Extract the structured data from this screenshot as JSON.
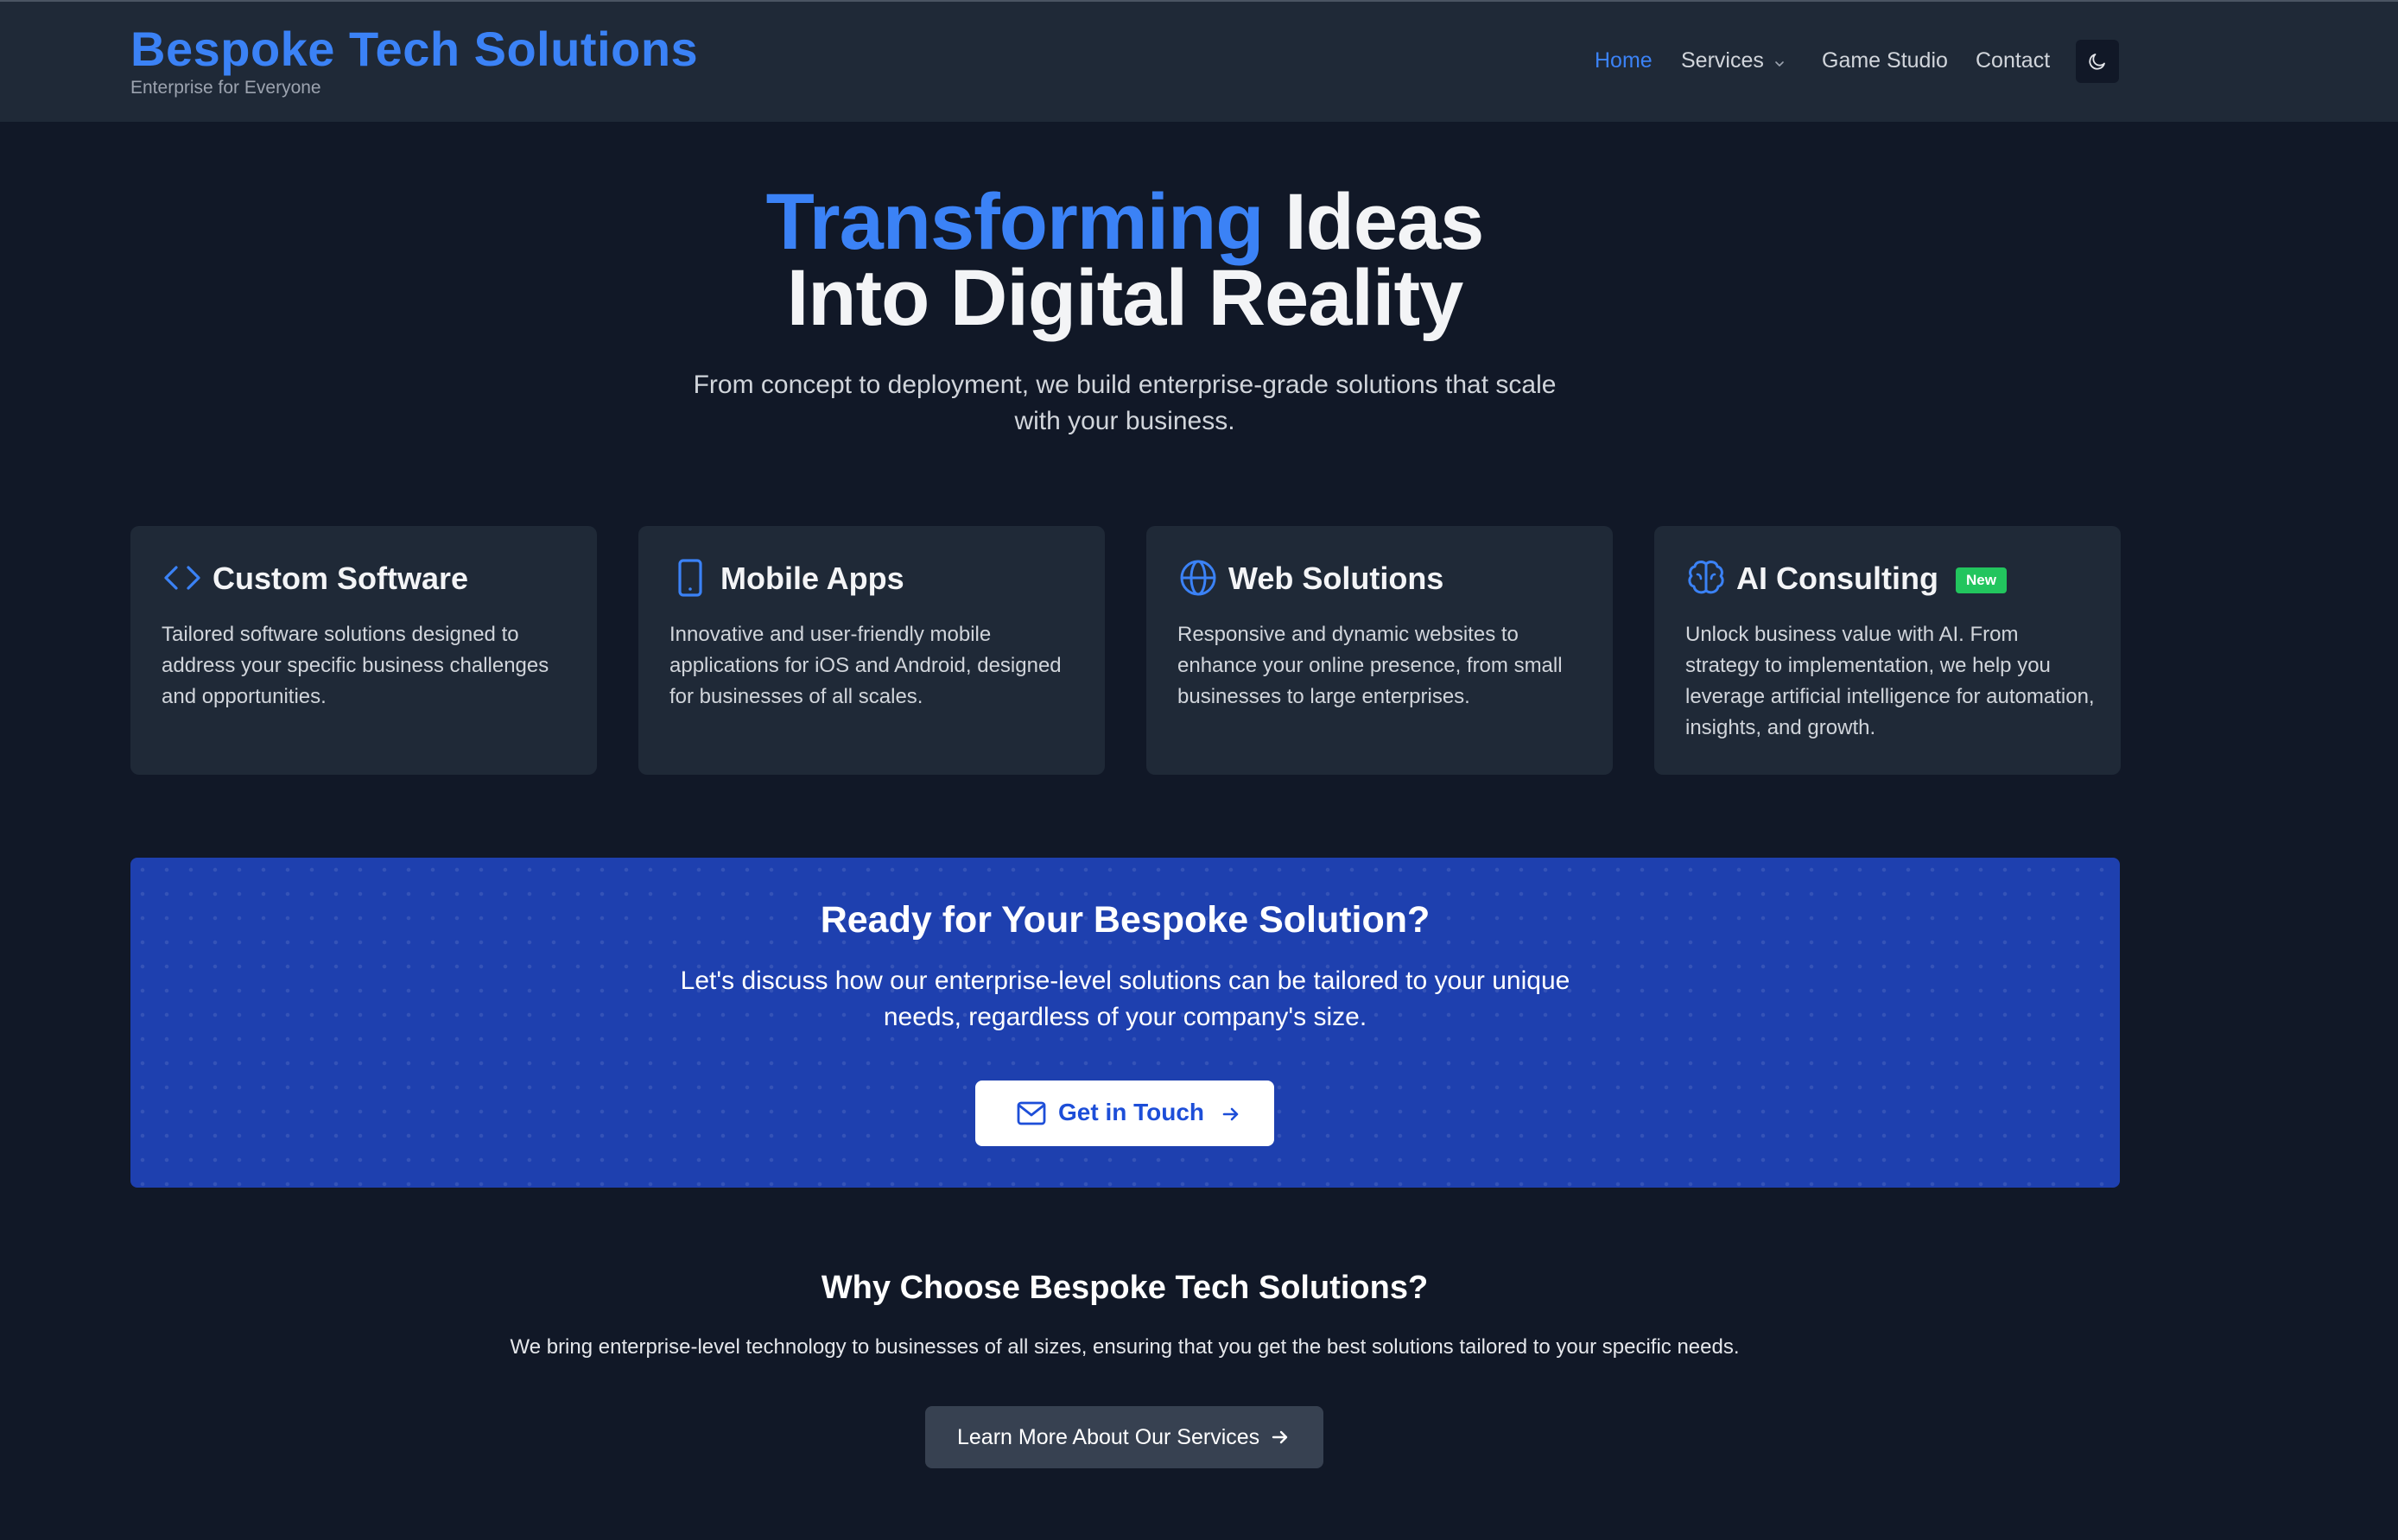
{
  "brand": {
    "title": "Bespoke Tech Solutions",
    "tagline": "Enterprise for Everyone"
  },
  "nav": {
    "items": [
      {
        "label": "Home",
        "active": true
      },
      {
        "label": "Services",
        "has_dropdown": true
      },
      {
        "label": "Game Studio"
      },
      {
        "label": "Contact"
      }
    ],
    "theme_toggle_icon": "moon-icon"
  },
  "hero": {
    "accent": "Transforming",
    "line1_rest": " Ideas",
    "line2": "Into Digital Reality",
    "subtitle": "From concept to deployment, we build enterprise-grade solutions that scale with your business."
  },
  "services": [
    {
      "icon": "code-icon",
      "title": "Custom Software",
      "description": "Tailored software solutions designed to address your specific business challenges and opportunities."
    },
    {
      "icon": "mobile-icon",
      "title": "Mobile Apps",
      "description": "Innovative and user-friendly mobile applications for iOS and Android, designed for businesses of all scales."
    },
    {
      "icon": "globe-icon",
      "title": "Web Solutions",
      "description": "Responsive and dynamic websites to enhance your online presence, from small businesses to large enterprises."
    },
    {
      "icon": "brain-icon",
      "title": "AI Consulting",
      "badge": "New",
      "description": "Unlock business value with AI. From strategy to implementation, we help you leverage artificial intelligence for automation, insights, and growth."
    }
  ],
  "cta": {
    "title": "Ready for Your Bespoke Solution?",
    "text": "Let's discuss how our enterprise-level solutions can be tailored to your unique needs, regardless of your company's size.",
    "button_label": "Get in Touch"
  },
  "why": {
    "title": "Why Choose Bespoke Tech Solutions?",
    "text": "We bring enterprise-level technology to businesses of all sizes, ensuring that you get the best solutions tailored to your specific needs.",
    "button_label": "Learn More About Our Services"
  },
  "colors": {
    "background": "#111827",
    "surface": "#1f2937",
    "accent": "#3b82f6",
    "cta": "#1e40af",
    "badge": "#22c55e"
  }
}
